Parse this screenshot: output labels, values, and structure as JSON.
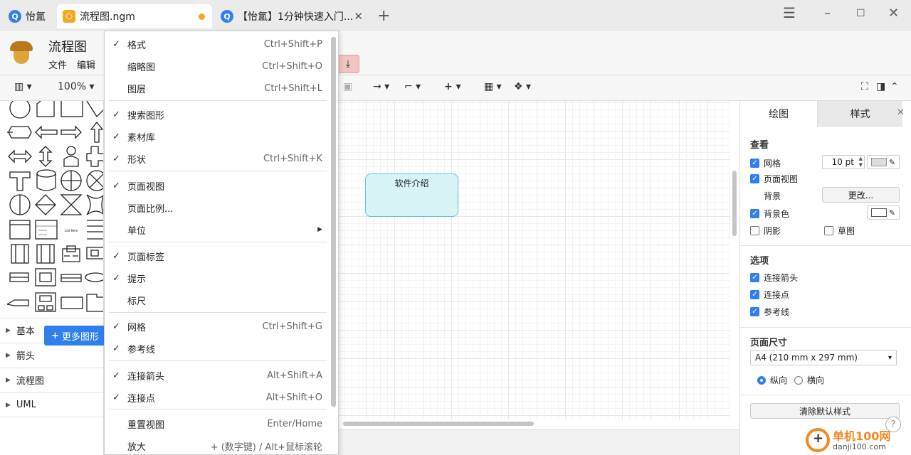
{
  "tabs": [
    {
      "label": "怡氲"
    },
    {
      "label": "流程图.ngm"
    },
    {
      "label": "【怡氲】1分钟快速入门..."
    }
  ],
  "app": {
    "title": "流程图",
    "menu": [
      "文件",
      "编辑"
    ]
  },
  "toolbar": {
    "zoom": "100%"
  },
  "left_panel": {
    "sections": [
      "基本",
      "箭头",
      "流程图",
      "UML"
    ],
    "more_shapes": "更多图形",
    "shape_text": "List Item"
  },
  "canvas": {
    "node_label": "软件介绍"
  },
  "menu": {
    "items": [
      {
        "label": "格式",
        "shortcut": "Ctrl+Shift+P",
        "checked": true
      },
      {
        "label": "缩略图",
        "shortcut": "Ctrl+Shift+O",
        "checked": false
      },
      {
        "label": "图层",
        "shortcut": "Ctrl+Shift+L",
        "checked": false
      },
      {
        "label": "搜索图形",
        "shortcut": "",
        "checked": true
      },
      {
        "label": "素材库",
        "shortcut": "",
        "checked": true
      },
      {
        "label": "形状",
        "shortcut": "Ctrl+Shift+K",
        "checked": true
      },
      {
        "label": "页面视图",
        "shortcut": "",
        "checked": true
      },
      {
        "label": "页面比例...",
        "shortcut": "",
        "checked": false
      },
      {
        "label": "单位",
        "shortcut": "",
        "checked": false
      },
      {
        "label": "页面标签",
        "shortcut": "",
        "checked": true
      },
      {
        "label": "提示",
        "shortcut": "",
        "checked": true
      },
      {
        "label": "标尺",
        "shortcut": "",
        "checked": false
      },
      {
        "label": "网格",
        "shortcut": "Ctrl+Shift+G",
        "checked": true
      },
      {
        "label": "参考线",
        "shortcut": "",
        "checked": true
      },
      {
        "label": "连接箭头",
        "shortcut": "Alt+Shift+A",
        "checked": true
      },
      {
        "label": "连接点",
        "shortcut": "Alt+Shift+O",
        "checked": true
      },
      {
        "label": "重置视图",
        "shortcut": "Enter/Home",
        "checked": false
      },
      {
        "label": "放大",
        "shortcut": "+ (数字键) / Alt+鼠标滚轮",
        "checked": false
      }
    ]
  },
  "right_panel": {
    "tabs": [
      "绘图",
      "样式"
    ],
    "view_heading": "查看",
    "grid_label": "网格",
    "grid_size": "10 pt",
    "page_view_label": "页面视图",
    "background_label": "背景",
    "change_button": "更改...",
    "bg_color_label": "背景色",
    "shadow_label": "阴影",
    "sketch_label": "草图",
    "options_heading": "选项",
    "connect_arrows_label": "连接箭头",
    "connect_points_label": "连接点",
    "guides_label": "参考线",
    "page_size_heading": "页面尺寸",
    "page_size_value": "A4 (210 mm x 297 mm)",
    "portrait_label": "纵向",
    "landscape_label": "横向",
    "clear_style_button": "清除默认样式"
  },
  "watermark": {
    "brand": "单机100网",
    "url": "danji100.com"
  },
  "colors": {
    "accent": "#2f80ed",
    "node_fill": "#d9f4f7",
    "node_border": "#5ac8d8",
    "modified_dot": "#f5a623"
  }
}
